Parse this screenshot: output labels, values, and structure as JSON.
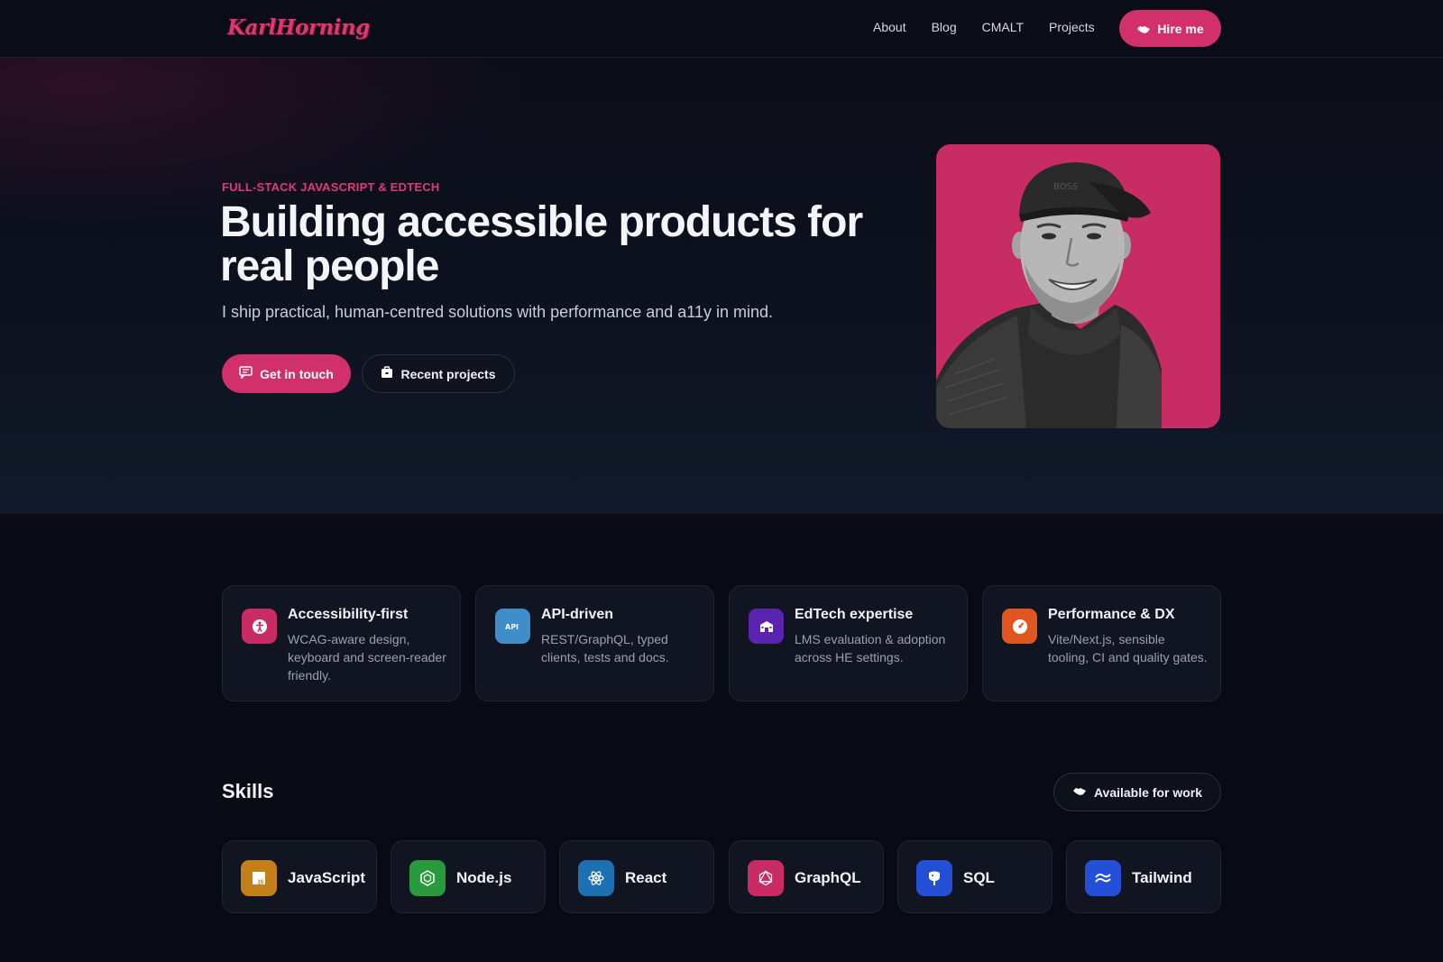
{
  "colors": {
    "accent": "#d1306a",
    "background": "#080b14",
    "card": "#101521"
  },
  "nav": {
    "logo": "KarlHorning",
    "links": [
      {
        "label": "About"
      },
      {
        "label": "Blog"
      },
      {
        "label": "CMALT"
      },
      {
        "label": "Projects"
      }
    ],
    "hire_label": "Hire me",
    "hire_icon": "handshake-icon"
  },
  "hero": {
    "eyebrow": "FULL-STACK JAVASCRIPT & EDTECH",
    "headline": "Building accessible products for real people",
    "subline": "I ship practical, human-centred solutions with performance and a11y in mind.",
    "cta_primary": {
      "label": "Get in touch",
      "icon": "message-icon"
    },
    "cta_secondary": {
      "label": "Recent projects",
      "icon": "briefcase-icon"
    },
    "portrait_icon": "portrait-photo"
  },
  "features": [
    {
      "title": "Accessibility-first",
      "desc": "WCAG-aware design, keyboard and screen-reader friendly.",
      "icon": "accessibility-icon",
      "color": "#c92c63"
    },
    {
      "title": "API-driven",
      "desc": "REST/GraphQL, typed clients, tests and docs.",
      "icon": "api-icon",
      "color": "#3f8dc9"
    },
    {
      "title": "EdTech expertise",
      "desc": "LMS evaluation & adoption across HE settings.",
      "icon": "school-icon",
      "color": "#5b24b0"
    },
    {
      "title": "Performance & DX",
      "desc": "Vite/Next.js, sensible tooling, CI and quality gates.",
      "icon": "gauge-icon",
      "color": "#e0561f"
    }
  ],
  "skills": {
    "title": "Skills",
    "available_label": "Available for work",
    "available_icon": "handshake-icon",
    "items": [
      {
        "label": "JavaScript",
        "icon": "javascript-icon",
        "color": "#c47f19"
      },
      {
        "label": "Node.js",
        "icon": "nodejs-icon",
        "color": "#2a9a3f"
      },
      {
        "label": "React",
        "icon": "react-icon",
        "color": "#1f6fb3"
      },
      {
        "label": "GraphQL",
        "icon": "graphql-icon",
        "color": "#c92c63"
      },
      {
        "label": "SQL",
        "icon": "database-icon",
        "color": "#2450d8"
      },
      {
        "label": "Tailwind",
        "icon": "tailwind-icon",
        "color": "#2450d8"
      }
    ]
  }
}
